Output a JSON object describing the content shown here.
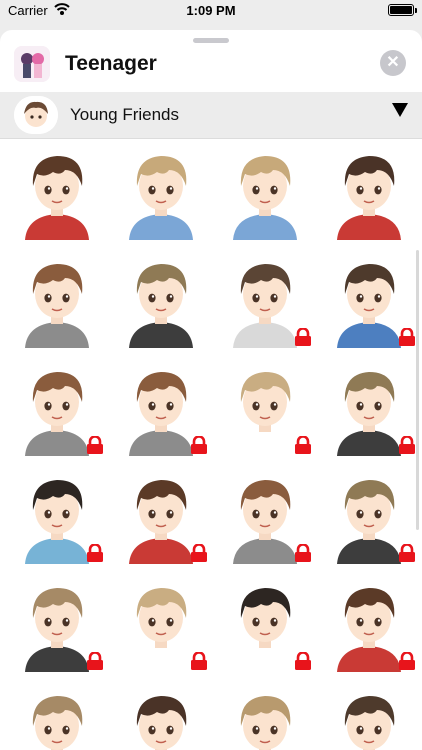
{
  "status": {
    "carrier": "Carrier",
    "time": "1:09 PM"
  },
  "header": {
    "title": "Teenager",
    "close_icon": "close-icon"
  },
  "pack": {
    "name": "Young Friends",
    "toggle_icon": "triangle-down-icon"
  },
  "colors": {
    "lock": "#e8141b",
    "sheet": "#ffffff",
    "bar": "#ececec"
  },
  "stickers": [
    {
      "hair": "#5b3a27",
      "shirt": "#c93a35",
      "locked": false
    },
    {
      "hair": "#c7a97a",
      "shirt": "#7ba6d6",
      "locked": false
    },
    {
      "hair": "#c7a97a",
      "shirt": "#7ba6d6",
      "locked": false
    },
    {
      "hair": "#4a3327",
      "shirt": "#c93a35",
      "locked": false
    },
    {
      "hair": "#8a5c3d",
      "shirt": "#8c8c8c",
      "locked": false
    },
    {
      "hair": "#8f7a55",
      "shirt": "#3d3d3d",
      "locked": false
    },
    {
      "hair": "#5b4535",
      "shirt": "#d9d9d9",
      "locked": true
    },
    {
      "hair": "#4e3a2c",
      "shirt": "#4d7fc0",
      "locked": true
    },
    {
      "hair": "#8a5c3d",
      "shirt": "#8c8c8c",
      "locked": true
    },
    {
      "hair": "#8a5c3d",
      "shirt": "#8c8c8c",
      "locked": true
    },
    {
      "hair": "#c9ad82",
      "shirt": "#ffffff",
      "locked": true
    },
    {
      "hair": "#8f7a55",
      "shirt": "#3d3d3d",
      "locked": true
    },
    {
      "hair": "#2d2622",
      "shirt": "#77b3d6",
      "locked": true
    },
    {
      "hair": "#5b3a27",
      "shirt": "#c93a35",
      "locked": true
    },
    {
      "hair": "#8a5c3d",
      "shirt": "#8c8c8c",
      "locked": true
    },
    {
      "hair": "#8f7a55",
      "shirt": "#3d3d3d",
      "locked": true
    },
    {
      "hair": "#a68a66",
      "shirt": "#3d3d3d",
      "locked": true
    },
    {
      "hair": "#c9ad82",
      "shirt": "#ffffff",
      "locked": true
    },
    {
      "hair": "#2d2622",
      "shirt": "#ffffff",
      "locked": true
    },
    {
      "hair": "#5b3a27",
      "shirt": "#c93a35",
      "locked": true
    },
    {
      "hair": "#a68a66",
      "shirt": "#8c8c8c",
      "locked": true
    },
    {
      "hair": "#4a3327",
      "shirt": "#d9d9d9",
      "locked": true
    },
    {
      "hair": "#b89a6e",
      "shirt": "#3d3d3d",
      "locked": true
    },
    {
      "hair": "#4e3a2c",
      "shirt": "#4d7fc0",
      "locked": true
    }
  ]
}
